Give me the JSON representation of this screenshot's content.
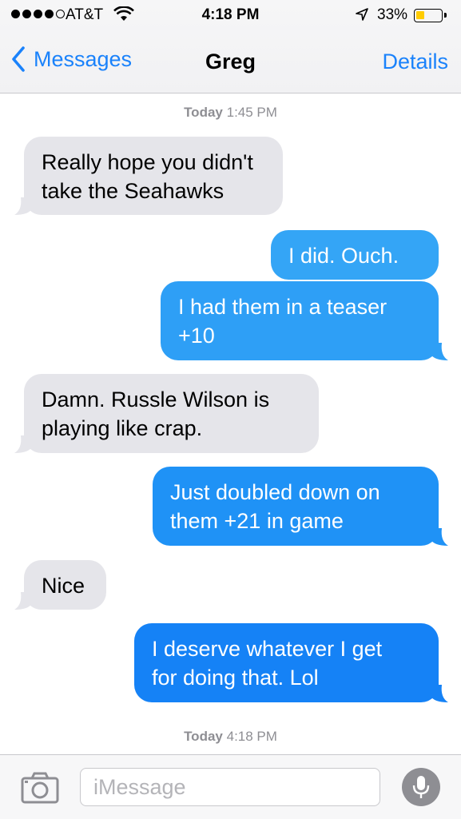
{
  "status_bar": {
    "carrier": "AT&T",
    "time": "4:18 PM",
    "battery_percent": "33%",
    "battery_level": 0.33,
    "signal_bars_filled": 4,
    "signal_bars_total": 5
  },
  "nav": {
    "back_label": "Messages",
    "title": "Greg",
    "details_label": "Details"
  },
  "timestamps": [
    {
      "day": "Today",
      "time": "1:45 PM"
    },
    {
      "day": "Today",
      "time": "4:18 PM"
    }
  ],
  "messages": [
    {
      "direction": "incoming",
      "lines": [
        "Really hope you didn't",
        "take the Seahawks"
      ]
    },
    {
      "direction": "outgoing",
      "lines": [
        "I did. Ouch."
      ]
    },
    {
      "direction": "outgoing",
      "lines": [
        "I had them in a teaser",
        "+10"
      ]
    },
    {
      "direction": "incoming",
      "lines": [
        "Damn. Russle Wilson is",
        "playing like crap."
      ]
    },
    {
      "direction": "outgoing",
      "lines": [
        "Just doubled down on",
        "them +21 in game"
      ]
    },
    {
      "direction": "incoming",
      "lines": [
        "Nice"
      ]
    },
    {
      "direction": "outgoing",
      "lines": [
        "I deserve whatever I get",
        "for doing that. Lol"
      ]
    }
  ],
  "input": {
    "placeholder": "iMessage",
    "value": ""
  },
  "icons": {
    "back": "chevron-left-icon",
    "camera": "camera-icon",
    "mic": "microphone-icon",
    "wifi": "wifi-icon",
    "location": "location-arrow-icon"
  },
  "colors": {
    "accent": "#1a82fb",
    "incoming_bubble": "#e5e5ea",
    "battery_fill": "#ffcc00"
  }
}
